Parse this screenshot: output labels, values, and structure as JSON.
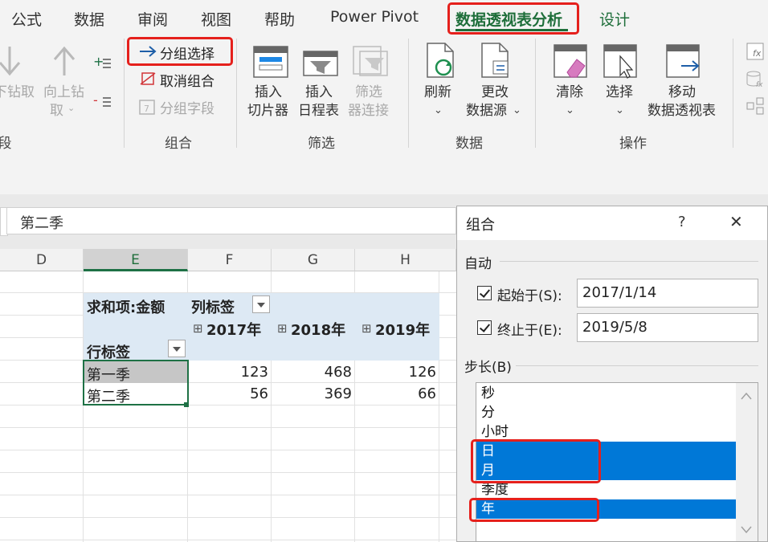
{
  "menu": {
    "tabs": [
      "公式",
      "数据",
      "审阅",
      "视图",
      "帮助",
      "Power Pivot",
      "数据透视表分析",
      "设计"
    ],
    "active_tab": "数据透视表分析"
  },
  "ribbon": {
    "drill": {
      "drill_down": "下钻取",
      "drill_up_line1": "向上钻",
      "drill_up_line2": "取",
      "group_label": "段"
    },
    "group": {
      "group_selection": "分组选择",
      "ungroup": "取消组合",
      "group_field": "分组字段",
      "label": "组合"
    },
    "filter": {
      "slicer_line1": "插入",
      "slicer_line2": "切片器",
      "timeline_line1": "插入",
      "timeline_line2": "日程表",
      "connections_line1": "筛选",
      "connections_line2": "器连接",
      "label": "筛选"
    },
    "data": {
      "refresh": "刷新",
      "change_source_line1": "更改",
      "change_source_line2": "数据源",
      "label": "数据"
    },
    "actions": {
      "clear": "清除",
      "select": "选择",
      "move_line1": "移动",
      "move_line2": "数据透视表",
      "label": "操作"
    }
  },
  "formula_bar": {
    "value": "第二季"
  },
  "columns": [
    "D",
    "E",
    "F",
    "G",
    "H"
  ],
  "selected_column": "E",
  "pivot": {
    "value_field": "求和项:金额",
    "col_label": "列标签",
    "row_label": "行标签",
    "years": [
      "2017年",
      "2018年",
      "2019年"
    ],
    "rows": [
      {
        "label": "第一季",
        "values": [
          "123",
          "468",
          "126"
        ]
      },
      {
        "label": "第二季",
        "values": [
          "56",
          "369",
          "66"
        ]
      }
    ]
  },
  "dialog": {
    "title": "组合",
    "help": "?",
    "close": "✕",
    "auto_section": "自动",
    "start_label": "起始于(S):",
    "start_value": "2017/1/14",
    "end_label": "终止于(E):",
    "end_value": "2019/5/8",
    "step_label": "步长(B)",
    "step_items": [
      {
        "label": "秒",
        "selected": false
      },
      {
        "label": "分",
        "selected": false
      },
      {
        "label": "小时",
        "selected": false
      },
      {
        "label": "日",
        "selected": true
      },
      {
        "label": "月",
        "selected": true
      },
      {
        "label": "季度",
        "selected": false
      },
      {
        "label": "年",
        "selected": true
      }
    ]
  },
  "colors": {
    "accent_green": "#1e6e3a",
    "highlight_red": "#e5201c",
    "selection_blue": "#0078d7",
    "pivot_header": "#dde9f4"
  }
}
